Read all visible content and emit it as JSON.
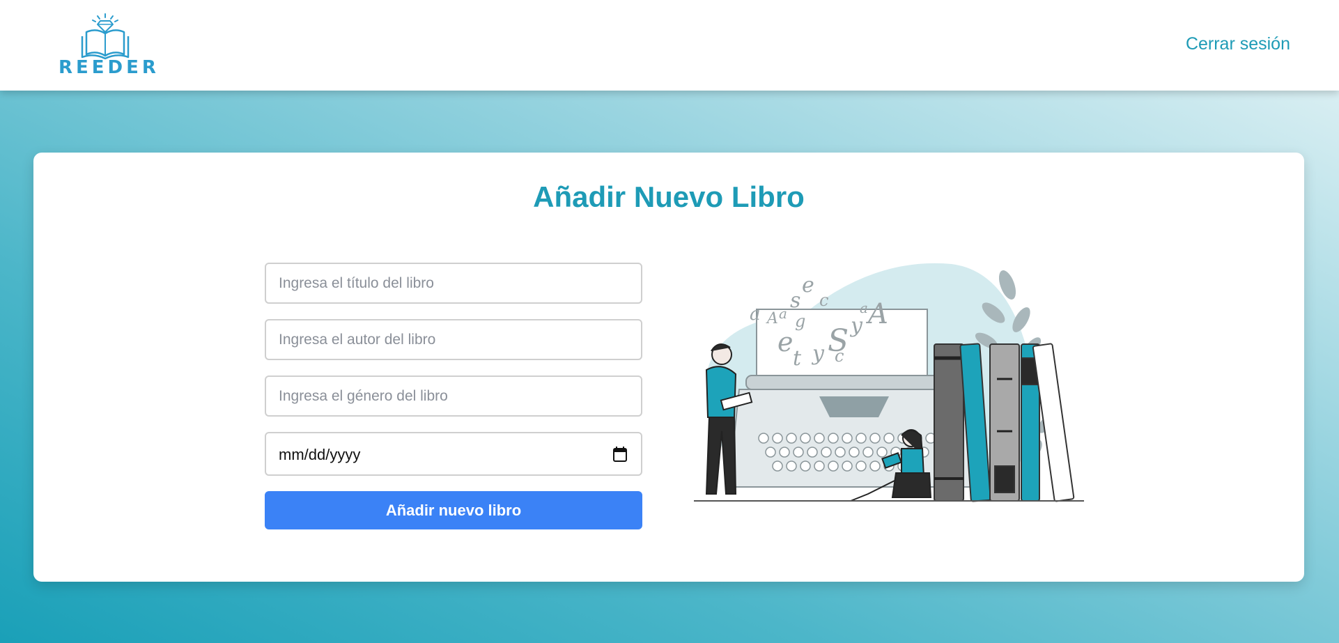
{
  "header": {
    "brand": "REEDER",
    "logout_label": "Cerrar sesión"
  },
  "main": {
    "title": "Añadir Nuevo Libro",
    "form": {
      "title_placeholder": "Ingresa el título del libro",
      "author_placeholder": "Ingresa el autor del libro",
      "genre_placeholder": "Ingresa el género del libro",
      "date_placeholder": "mm/dd/yyyy",
      "submit_label": "Añadir nuevo libro"
    },
    "illustration": {
      "letters": [
        "a",
        "A",
        "a",
        "s",
        "e",
        "c",
        "g",
        "e",
        "t",
        "y",
        "S",
        "y",
        "c",
        "a",
        "A"
      ]
    }
  },
  "colors": {
    "accent": "#1e9bb6",
    "button": "#3b82f6",
    "logo": "#2b9ccd"
  },
  "icons": {
    "logo": "open-book-diamond-icon",
    "calendar": "calendar-icon"
  }
}
